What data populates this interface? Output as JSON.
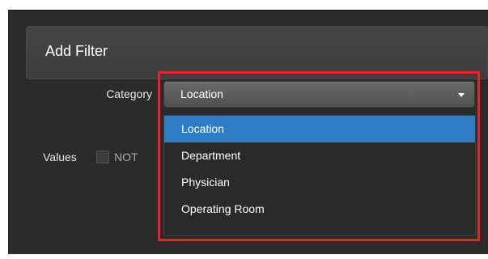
{
  "header": {
    "title": "Add Filter"
  },
  "form": {
    "category_label": "Category",
    "values_label": "Values",
    "not_label": "NOT",
    "not_checked": false
  },
  "category_select": {
    "selected_value": "Location",
    "options": [
      "Location",
      "Department",
      "Physician",
      "Operating Room"
    ],
    "highlighted_option": "Location"
  },
  "colors": {
    "highlight_border": "#e5232a",
    "selected_option": "#2f7cc6",
    "panel_background": "#2b2b2b"
  },
  "icons": {
    "select_caret": "caret-down-icon"
  }
}
